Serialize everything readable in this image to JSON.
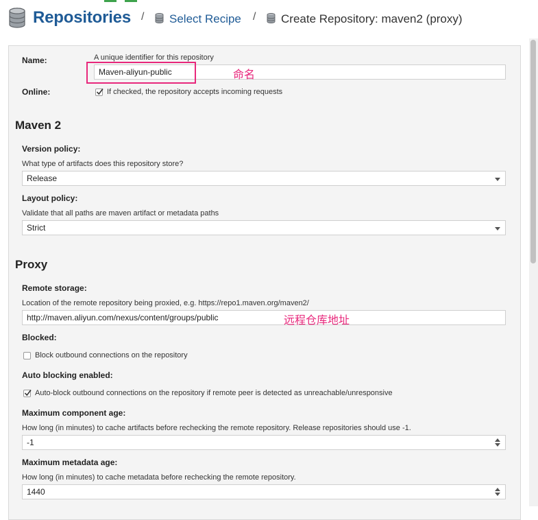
{
  "breadcrumb": {
    "title": "Repositories",
    "sep1": "/",
    "link": "Select Recipe",
    "sep2": "/",
    "current": "Create Repository: maven2 (proxy)"
  },
  "form": {
    "name": {
      "label": "Name:",
      "help": "A unique identifier for this repository",
      "value": "Maven-aliyun-public",
      "annotation": "命名"
    },
    "online": {
      "label": "Online:",
      "checked": true,
      "text": "If checked, the repository accepts incoming requests"
    },
    "maven_section": "Maven 2",
    "version_policy": {
      "label": "Version policy:",
      "help": "What type of artifacts does this repository store?",
      "value": "Release"
    },
    "layout_policy": {
      "label": "Layout policy:",
      "help": "Validate that all paths are maven artifact or metadata paths",
      "value": "Strict"
    },
    "proxy_section": "Proxy",
    "remote_storage": {
      "label": "Remote storage:",
      "help": "Location of the remote repository being proxied, e.g. https://repo1.maven.org/maven2/",
      "value": "http://maven.aliyun.com/nexus/content/groups/public",
      "annotation": "远程仓库地址"
    },
    "blocked": {
      "label": "Blocked:",
      "checked": false,
      "text": "Block outbound connections on the repository"
    },
    "auto_blocking": {
      "label": "Auto blocking enabled:",
      "checked": true,
      "text": "Auto-block outbound connections on the repository if remote peer is detected as unreachable/unresponsive"
    },
    "max_component_age": {
      "label": "Maximum component age:",
      "help": "How long (in minutes) to cache artifacts before rechecking the remote repository. Release repositories should use -1.",
      "value": "-1"
    },
    "max_metadata_age": {
      "label": "Maximum metadata age:",
      "help": "How long (in minutes) to cache metadata before rechecking the remote repository.",
      "value": "1440"
    }
  },
  "colors": {
    "link": "#1f5b96",
    "annotation": "#e8277b",
    "tab_accent": "#3fa34d"
  }
}
